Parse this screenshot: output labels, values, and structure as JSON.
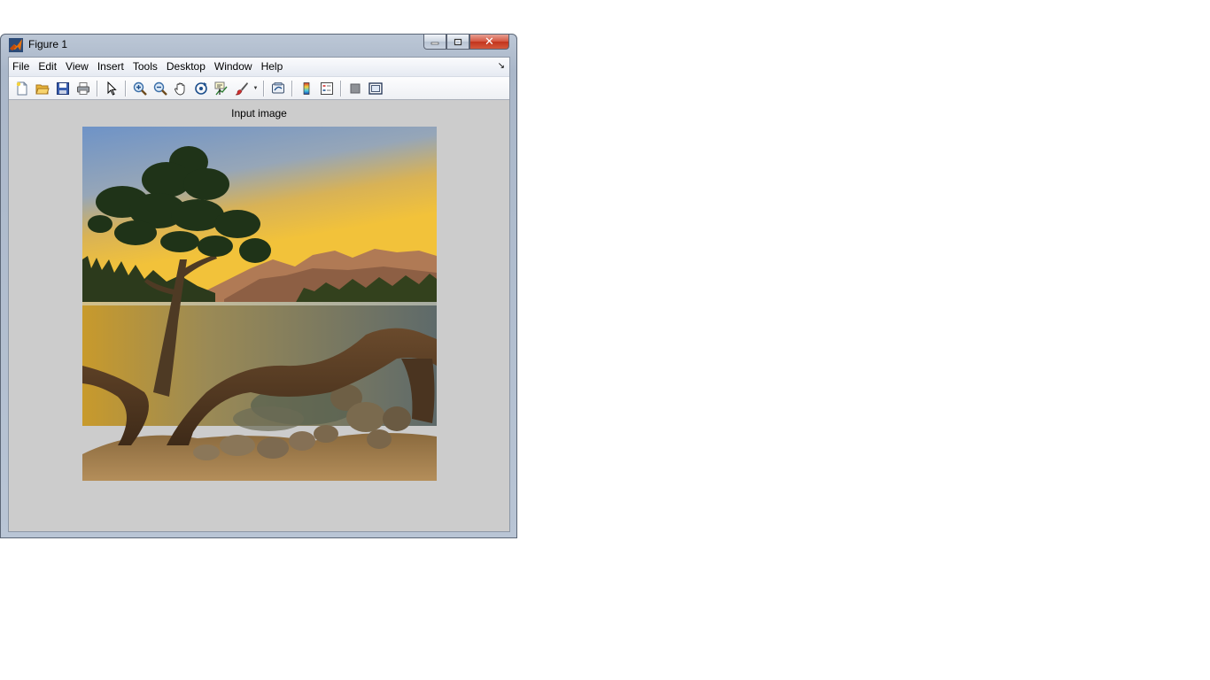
{
  "window": {
    "title": "Figure 1",
    "close_glyph": "✕"
  },
  "menu": {
    "items": [
      "File",
      "Edit",
      "View",
      "Insert",
      "Tools",
      "Desktop",
      "Window",
      "Help"
    ],
    "dock_glyph": "↘"
  },
  "toolbar": {
    "buttons": [
      "new-figure-icon",
      "open-file-icon",
      "save-figure-icon",
      "print-figure-icon",
      "edit-plot-icon",
      "zoom-in-icon",
      "zoom-out-icon",
      "pan-icon",
      "rotate-3d-icon",
      "data-cursor-icon",
      "brush-icon",
      "link-plot-icon",
      "insert-colorbar-icon",
      "insert-legend-icon",
      "hide-plot-tools-icon",
      "show-plot-tools-icon"
    ]
  },
  "axes": {
    "title": "Input image"
  },
  "colors": {
    "figure_background": "#cccccc",
    "sky_top": "#6e93c7",
    "sunset": "#f2c23a",
    "water": "#6b6e56"
  }
}
